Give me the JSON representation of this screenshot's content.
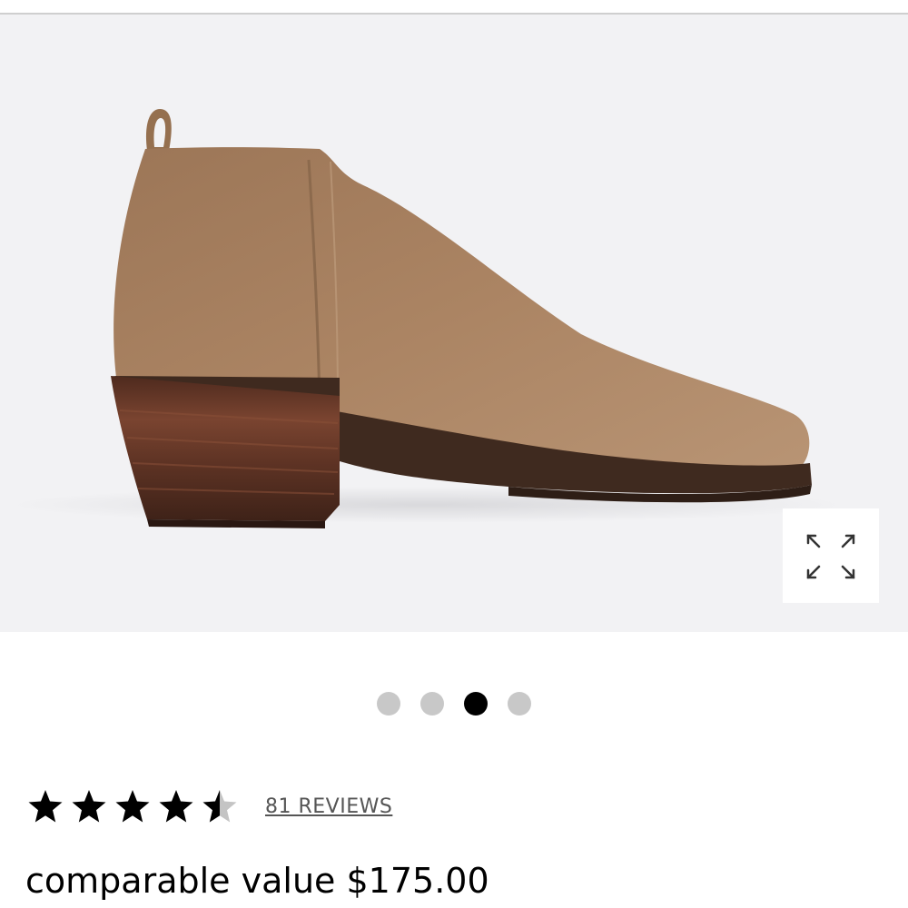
{
  "product": {
    "image_icon": "ankle-boot-photo",
    "gallery": {
      "total": 4,
      "active_index": 2
    },
    "zoom_icon": "expand-arrows-icon"
  },
  "rating": {
    "value": 4.5,
    "max": 5,
    "reviews_link": "81 REVIEWS"
  },
  "price": {
    "line": "comparable value $175.00"
  },
  "colors": {
    "suede": "#a9825f",
    "heel": "#6b3a28",
    "background": "#f2f2f4",
    "dot_active": "#000000",
    "dot_inactive": "#c8c8c8"
  }
}
